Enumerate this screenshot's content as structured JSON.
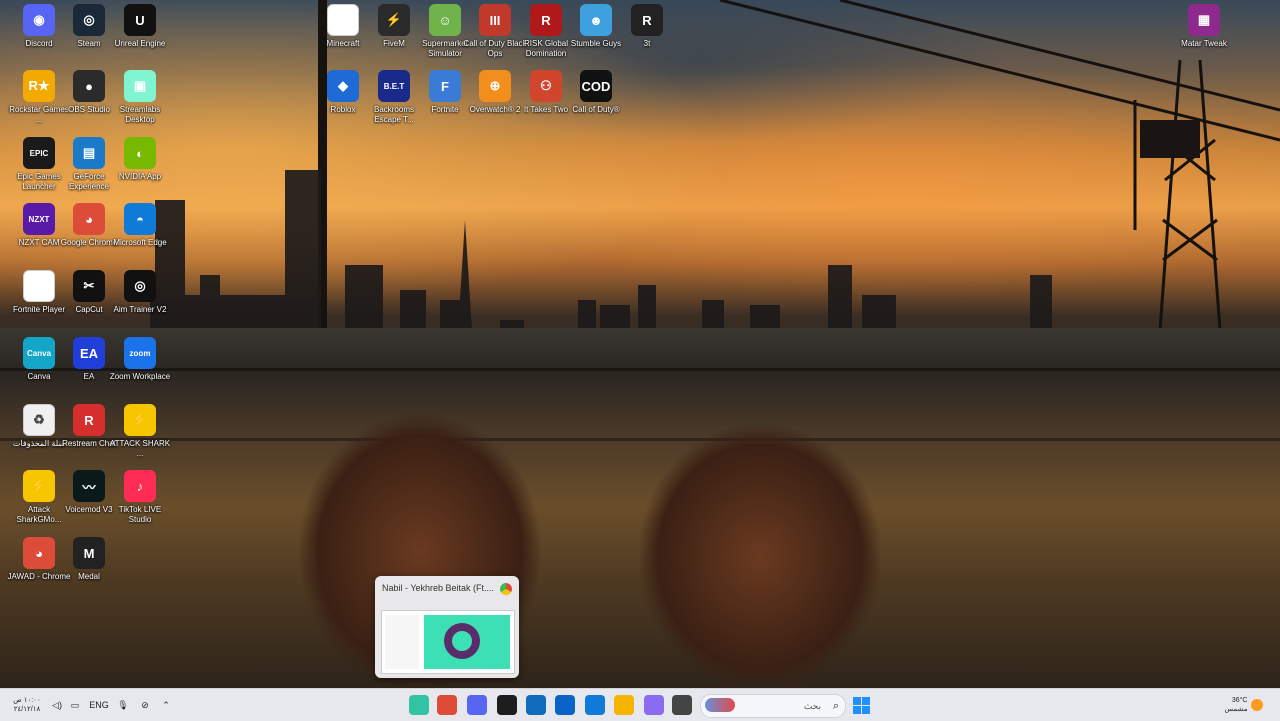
{
  "desktop_icons": [
    {
      "label": "Discord",
      "glyph": "◉",
      "color": "#5865f2"
    },
    {
      "label": "Steam",
      "glyph": "◎",
      "color": "#1b2838"
    },
    {
      "label": "Unreal Engine",
      "glyph": "U",
      "color": "#111111"
    },
    {
      "label": "Minecraft",
      "glyph": "",
      "color": "#ffffff"
    },
    {
      "label": "FiveM",
      "glyph": "⚡",
      "color": "#2a2a2a"
    },
    {
      "label": "Supermarket Simulator",
      "glyph": "☺",
      "color": "#6fb34a"
    },
    {
      "label": "Call of Duty Black Ops",
      "glyph": "III",
      "color": "#c0392b"
    },
    {
      "label": "RISK Global Domination",
      "glyph": "R",
      "color": "#b01919"
    },
    {
      "label": "Stumble Guys",
      "glyph": "☻",
      "color": "#3fa0e0"
    },
    {
      "label": "3t",
      "glyph": "R",
      "color": "#222222"
    },
    {
      "label": "Matar Tweak",
      "glyph": "▦",
      "color": "#8e2a8e"
    },
    {
      "label": "Rockstar Games ...",
      "glyph": "R★",
      "color": "#f2a900"
    },
    {
      "label": "OBS Studio",
      "glyph": "●",
      "color": "#2b2b2b"
    },
    {
      "label": "Streamlabs Desktop",
      "glyph": "▣",
      "color": "#80f5d2"
    },
    {
      "label": "Roblox",
      "glyph": "◆",
      "color": "#1e6bd6"
    },
    {
      "label": "Backrooms Escape T...",
      "glyph": "B.E.T",
      "color": "#1a2a8a"
    },
    {
      "label": "Fortnite",
      "glyph": "F",
      "color": "#3a7bd5"
    },
    {
      "label": "Overwatch® 2",
      "glyph": "⊕",
      "color": "#f28e1c"
    },
    {
      "label": "It Takes Two",
      "glyph": "⚇",
      "color": "#d0452c"
    },
    {
      "label": "Call of Duty®",
      "glyph": "COD",
      "color": "#111111"
    },
    {
      "label": "Epic Games Launcher",
      "glyph": "EPIC",
      "color": "#1a1a1a"
    },
    {
      "label": "GeForce Experience",
      "glyph": "▤",
      "color": "#1a7ac8"
    },
    {
      "label": "NVIDIA App",
      "glyph": "◐",
      "color": "#76b900"
    },
    {
      "label": "NZXT CAM",
      "glyph": "NZXT",
      "color": "#5a1aa8"
    },
    {
      "label": "Google Chrome",
      "glyph": "◕",
      "color": "#dd4b39"
    },
    {
      "label": "Microsoft Edge",
      "glyph": "◓",
      "color": "#0f7ad8"
    },
    {
      "label": "Fortnite Player",
      "glyph": "",
      "color": "#ffffff"
    },
    {
      "label": "CapCut",
      "glyph": "✂",
      "color": "#111111"
    },
    {
      "label": "Aim Trainer V2",
      "glyph": "◎",
      "color": "#111111"
    },
    {
      "label": "Canva",
      "glyph": "Canva",
      "color": "#14a6c9"
    },
    {
      "label": "EA",
      "glyph": "EA",
      "color": "#1f3fd8"
    },
    {
      "label": "Zoom Workplace",
      "glyph": "zoom",
      "color": "#1a73e8"
    },
    {
      "label": "سلة المحذوفات",
      "glyph": "♻",
      "color": "#f0f0f0"
    },
    {
      "label": "Restream Chat",
      "glyph": "R",
      "color": "#d62d2d"
    },
    {
      "label": "ATTACK SHARK ...",
      "glyph": "⚡",
      "color": "#f6c600"
    },
    {
      "label": "Attack SharkGMo...",
      "glyph": "⚡",
      "color": "#f6c600"
    },
    {
      "label": "Voicemod V3",
      "glyph": "〰",
      "color": "#0a1a1a"
    },
    {
      "label": "TikTok LIVE Studio",
      "glyph": "♪",
      "color": "#fe2c55"
    },
    {
      "label": "JAWAD - Chrome",
      "glyph": "◕",
      "color": "#dd4b39"
    },
    {
      "label": "Medal",
      "glyph": "M",
      "color": "#222222"
    }
  ],
  "preview": {
    "title": "Nabil - Yekhreb Beitak (Ft...."
  },
  "taskbar": {
    "clock_time": "١٠:٠٠ ص",
    "clock_date": "٢٤/١٢/١٨",
    "language": "ENG",
    "search_placeholder": "بحث",
    "weather_temp": "36°C",
    "weather_desc": "مشمس",
    "apps": [
      {
        "name": "streamlabs",
        "color": "#31c3a2"
      },
      {
        "name": "chrome",
        "color": "#dd4b39"
      },
      {
        "name": "discord",
        "color": "#5865f2"
      },
      {
        "name": "fivem",
        "color": "#1d1d1d"
      },
      {
        "name": "store",
        "color": "#0f6cbd"
      },
      {
        "name": "outlook",
        "color": "#0a64c8"
      },
      {
        "name": "edge",
        "color": "#0f7ad8"
      },
      {
        "name": "file-explorer",
        "color": "#f4b400"
      },
      {
        "name": "copilot",
        "color": "#8a6cf0"
      },
      {
        "name": "task-view",
        "color": "#444444"
      }
    ]
  }
}
